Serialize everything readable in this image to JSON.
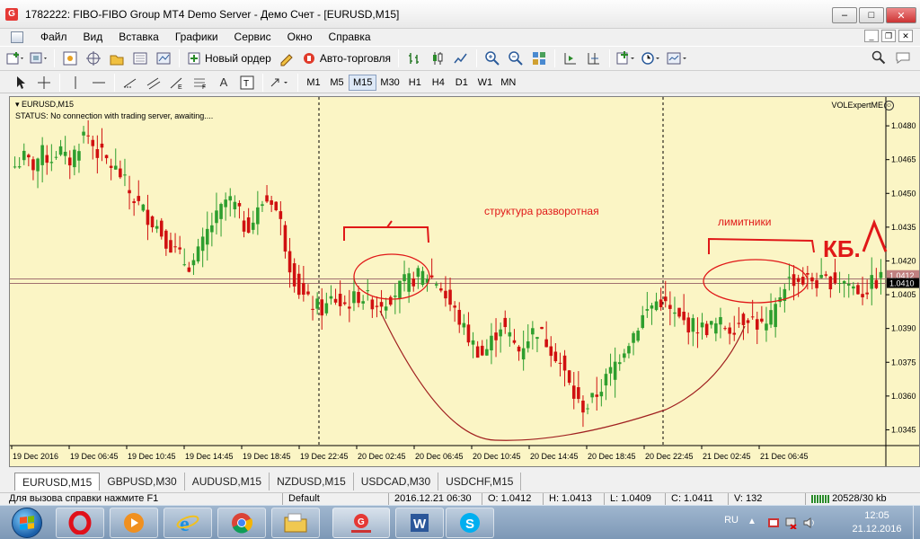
{
  "window": {
    "title": "1782222: FIBO-FIBO Group MT4 Demo Server - Демо Счет - [EURUSD,M15]",
    "app_icon": "G",
    "buttons": [
      "–",
      "□",
      "✕"
    ]
  },
  "menu": [
    "Файл",
    "Вид",
    "Вставка",
    "Графики",
    "Сервис",
    "Окно",
    "Справка"
  ],
  "toolbar": {
    "new_order": "Новый ордер",
    "auto_trading": "Авто-торговля"
  },
  "timeframes": [
    "M1",
    "M5",
    "M15",
    "M30",
    "H1",
    "H4",
    "D1",
    "W1",
    "MN"
  ],
  "active_timeframe": "M15",
  "chart": {
    "symbol_header": "EURUSD,M15",
    "status": "STATUS:   No connection with trading server, awaiting....",
    "expert": "VOLExpertME",
    "annotations": {
      "structure": "структура разворотная",
      "limit": "лимитники",
      "kb": "КБ."
    },
    "current_price_label": "1.0410",
    "upper_price_label": "1.0412"
  },
  "chart_data": {
    "type": "candlestick",
    "symbol": "EURUSD",
    "timeframe": "M15",
    "ylim": [
      1.0338,
      1.0492
    ],
    "y_ticks": [
      "1.0480",
      "1.0465",
      "1.0450",
      "1.0435",
      "1.0420",
      "1.0405",
      "1.0390",
      "1.0375",
      "1.0360",
      "1.0345"
    ],
    "x_ticks": [
      "19 Dec 2016",
      "19 Dec 06:45",
      "19 Dec 10:45",
      "19 Dec 14:45",
      "19 Dec 18:45",
      "19 Dec 22:45",
      "20 Dec 02:45",
      "20 Dec 06:45",
      "20 Dec 10:45",
      "20 Dec 14:45",
      "20 Dec 18:45",
      "20 Dec 22:45",
      "21 Dec 02:45",
      "21 Dec 06:45"
    ],
    "horizontal_lines": [
      1.0412,
      1.041
    ],
    "close_path": [
      1.0462,
      1.0466,
      1.0462,
      1.0468,
      1.0465,
      1.047,
      1.0463,
      1.047,
      1.0478,
      1.047,
      1.0466,
      1.0462,
      1.0458,
      1.045,
      1.0445,
      1.044,
      1.0436,
      1.043,
      1.0425,
      1.042,
      1.0418,
      1.0425,
      1.0435,
      1.044,
      1.0448,
      1.0444,
      1.0435,
      1.0438,
      1.0446,
      1.0448,
      1.0438,
      1.042,
      1.0408,
      1.0402,
      1.04,
      1.0398,
      1.0404,
      1.04,
      1.0402,
      1.0405,
      1.0403,
      1.0401,
      1.0403,
      1.0406,
      1.041,
      1.0412,
      1.0414,
      1.0413,
      1.041,
      1.0402,
      1.0396,
      1.0388,
      1.0382,
      1.0378,
      1.0385,
      1.0392,
      1.0386,
      1.038,
      1.0386,
      1.039,
      1.0385,
      1.038,
      1.0372,
      1.0362,
      1.0355,
      1.0356,
      1.0362,
      1.0368,
      1.0375,
      1.0382,
      1.0388,
      1.0395,
      1.04,
      1.0403,
      1.0398,
      1.0394,
      1.0392,
      1.0391,
      1.039,
      1.0391,
      1.0392,
      1.039,
      1.0393,
      1.0396,
      1.0392,
      1.039,
      1.0398,
      1.041,
      1.0412,
      1.0411,
      1.0412,
      1.041,
      1.0411,
      1.0412,
      1.0411,
      1.0408,
      1.0406,
      1.041,
      1.0412
    ]
  },
  "tabs": [
    "EURUSD,M15",
    "GBPUSD,M30",
    "AUDUSD,M15",
    "NZDUSD,M15",
    "USDCAD,M30",
    "USDCHF,M15"
  ],
  "statusbar": {
    "help": "Для вызова справки нажмите F1",
    "profile": "Default",
    "datetime": "2016.12.21 06:30",
    "open": "O: 1.0412",
    "high": "H: 1.0413",
    "low": "L: 1.0409",
    "close": "C: 1.0411",
    "volume": "V: 132",
    "traffic": "20528/30 kb"
  },
  "taskbar": {
    "lang": "RU",
    "time": "12:05",
    "date": "21.12.2016"
  }
}
